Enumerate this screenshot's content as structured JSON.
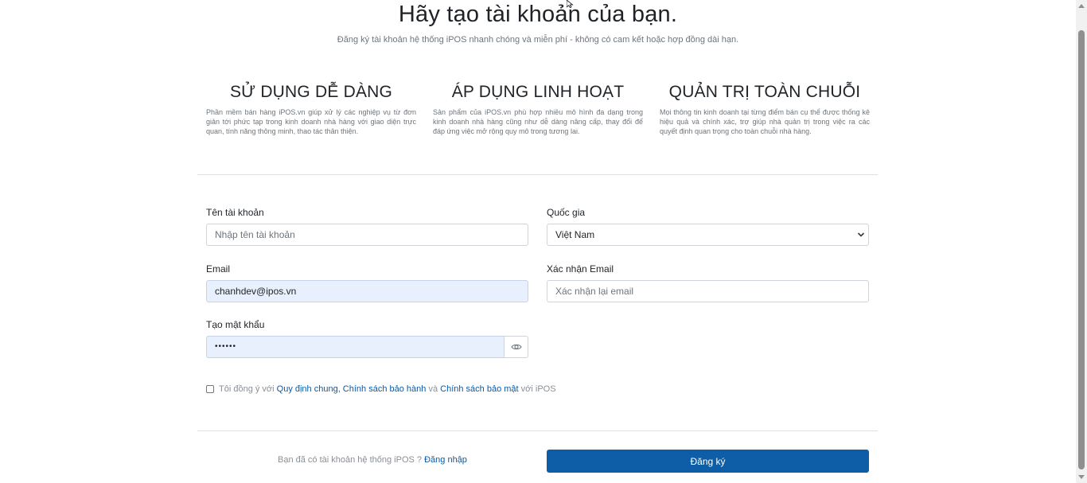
{
  "header": {
    "title": "Hãy tạo tài khoản của bạn.",
    "subtitle": "Đăng ký tài khoản hệ thống iPOS nhanh chóng và miễn phí - không có cam kết hoặc hợp đồng dài hạn."
  },
  "features": [
    {
      "title": "SỬ DỤNG DỄ DÀNG",
      "text": "Phần mềm bán hàng iPOS.vn giúp xử lý các nghiệp vụ từ đơn giản tới phức tạp trong kinh doanh nhà hàng với giao diện trực quan, tính năng thông minh, thao tác thân thiện."
    },
    {
      "title": "ÁP DỤNG LINH HOẠT",
      "text": "Sản phẩm của iPOS.vn phù hợp nhiều mô hình đa dạng trong kinh doanh nhà hàng cũng như dễ dàng nâng cấp, thay đổi để đáp ứng việc mở rộng quy mô trong tương lai."
    },
    {
      "title": "QUẢN TRỊ TOÀN CHUỖI",
      "text": "Mọi thông tin kinh doanh tại từng điểm bán cụ thể được thống kê hiệu quả và chính xác, trợ giúp nhà quản trị trong việc ra các quyết định quan trọng cho toàn chuỗi nhà hàng."
    }
  ],
  "form": {
    "username": {
      "label": "Tên tài khoản",
      "placeholder": "Nhập tên tài khoản",
      "value": ""
    },
    "country": {
      "label": "Quốc gia",
      "value": "Việt Nam"
    },
    "email": {
      "label": "Email",
      "value": "chanhdev@ipos.vn"
    },
    "confirm_email": {
      "label": "Xác nhận Email",
      "placeholder": "Xác nhận lại email",
      "value": ""
    },
    "password": {
      "label": "Tạo mật khẩu",
      "masked_value": "••••••"
    },
    "agree": {
      "prefix": "Tôi đồng ý với",
      "link1": "Quy định chung, Chính sách bảo hành",
      "middle": "và",
      "link2": "Chính sách bảo mật",
      "suffix": "với iPOS",
      "checked": false
    }
  },
  "footer": {
    "have_account": "Bạn đã có tài khoản hệ thống iPOS ?",
    "login_link": "Đăng nhập",
    "submit_label": "Đăng ký"
  },
  "colors": {
    "primary": "#0d5ea6",
    "link": "#0c5aa6",
    "autofill_bg": "#e8f0fe"
  },
  "icons": {
    "password_toggle": "eye-icon",
    "select_arrow": "chevron-down-icon",
    "cursor": "mouse-pointer-icon"
  }
}
